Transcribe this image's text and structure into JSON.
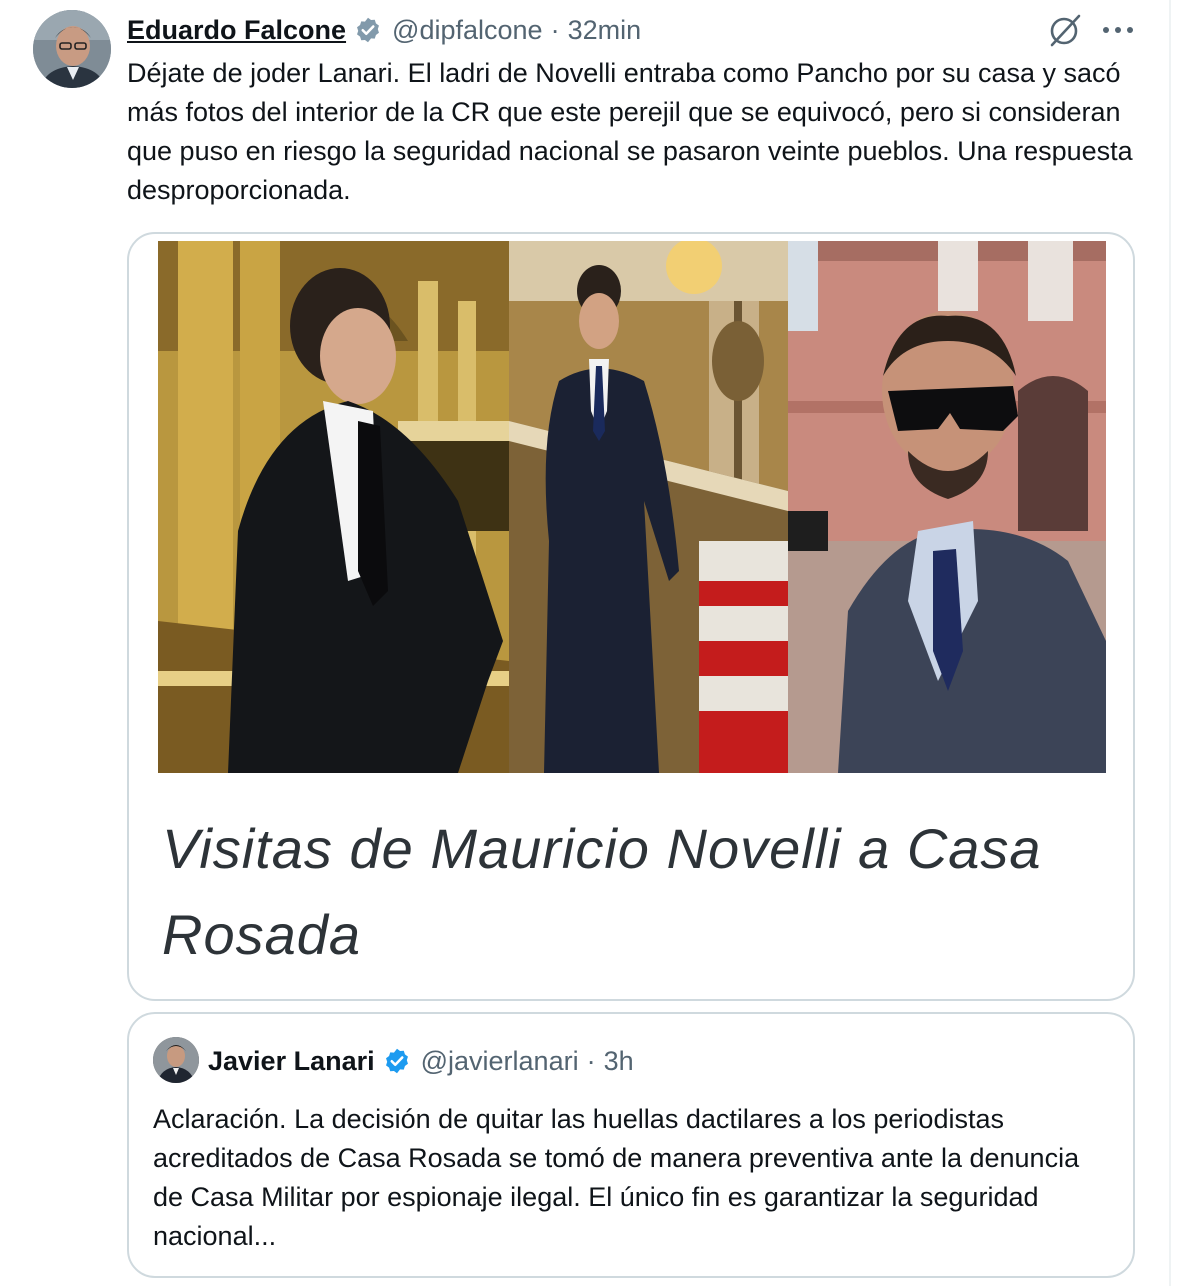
{
  "tweet": {
    "author_name": "Eduardo Falcone",
    "handle": "@dipfalcone",
    "separator": "·",
    "time": "32min",
    "text": "Déjate de joder Lanari. El ladri de Novelli entraba como Pancho por su casa y sacó más fotos del interior de la CR que este perejil que se equivocó, pero si consideran que puso en riesgo la seguridad nacional se pasaron veinte pueblos. Una respuesta desproporcionada.",
    "card": {
      "title": "Visitas de Mauricio Novelli a Casa Rosada"
    }
  },
  "quoted": {
    "author_name": "Javier Lanari",
    "handle": "@javierlanari",
    "separator": "·",
    "time": "3h",
    "text": "Aclaración. La decisión de quitar las huellas dactilares a los periodistas acreditados de Casa Rosada se tomó de manera preventiva ante la denuncia de Casa Militar por espionaje ilegal. El único fin es garantizar la seguridad nacional..."
  },
  "icons": {
    "verified": "verified-badge-icon",
    "grok": "grok-icon",
    "more": "more-options-icon"
  },
  "colors": {
    "verified": "#1d9bf0",
    "secondary_text": "#536471",
    "border": "#cfd9de"
  }
}
